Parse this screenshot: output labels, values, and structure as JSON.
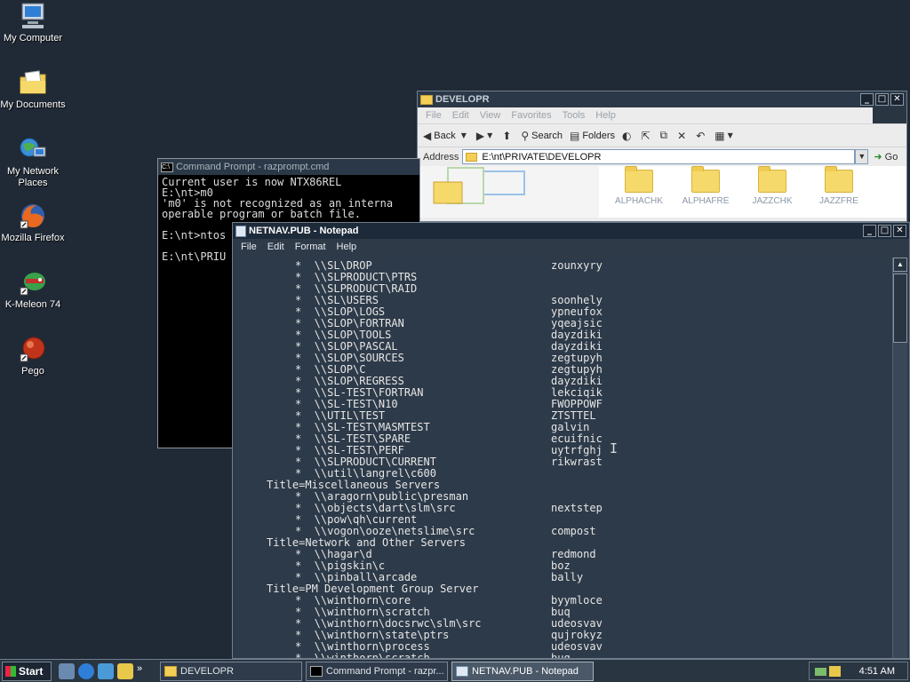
{
  "desktop": {
    "icons": [
      {
        "label": "My Computer"
      },
      {
        "label": "My Documents"
      },
      {
        "label": "My Network Places"
      },
      {
        "label": "Mozilla Firefox"
      },
      {
        "label": "K-Meleon 74"
      },
      {
        "label": "Pego"
      }
    ]
  },
  "explorer": {
    "title": "DEVELOPR",
    "menu": [
      "File",
      "Edit",
      "View",
      "Favorites",
      "Tools",
      "Help"
    ],
    "toolbar": {
      "back": "Back",
      "search": "Search",
      "folders": "Folders"
    },
    "address_label": "Address",
    "address_value": "E:\\nt\\PRIVATE\\DEVELOPR",
    "go_label": "Go",
    "folders": [
      "ALPHACHK",
      "ALPHAFRE",
      "JAZZCHK",
      "JAZZFRE"
    ]
  },
  "cmd": {
    "title": "Command Prompt - razprompt.cmd",
    "lines": [
      "Current user is now NTX86REL",
      "E:\\nt>m0",
      "'m0' is not recognized as an interna",
      "operable program or batch file.",
      "",
      "E:\\nt>ntos",
      "",
      "E:\\nt\\PRIU"
    ]
  },
  "notepad": {
    "title": "NETNAV.PUB - Notepad",
    "menu": [
      "File",
      "Edit",
      "Format",
      "Help"
    ],
    "rows": [
      {
        "a": "*  \\\\SL\\DROP",
        "b": "zounxyry"
      },
      {
        "a": "*  \\\\SLPRODUCT\\PTRS",
        "b": ""
      },
      {
        "a": "*  \\\\SLPRODUCT\\RAID",
        "b": ""
      },
      {
        "a": "*  \\\\SL\\USERS",
        "b": "soonhely"
      },
      {
        "a": "*  \\\\SLOP\\LOGS",
        "b": "ypneufox"
      },
      {
        "a": "*  \\\\SLOP\\FORTRAN",
        "b": "yqeajsic"
      },
      {
        "a": "*  \\\\SLOP\\TOOLS",
        "b": "dayzdiki"
      },
      {
        "a": "*  \\\\SLOP\\PASCAL",
        "b": "dayzdiki"
      },
      {
        "a": "*  \\\\SLOP\\SOURCES",
        "b": "zegtupyh"
      },
      {
        "a": "*  \\\\SLOP\\C",
        "b": "zegtupyh"
      },
      {
        "a": "*  \\\\SLOP\\REGRESS",
        "b": "dayzdiki"
      },
      {
        "a": "*  \\\\SL-TEST\\FORTRAN",
        "b": "lekciqik"
      },
      {
        "a": "*  \\\\SL-TEST\\N10",
        "b": "FWOPPOWF"
      },
      {
        "a": "*  \\\\UTIL\\TEST",
        "b": "ZTSTTEL"
      },
      {
        "a": "*  \\\\SL-TEST\\MASMTEST",
        "b": "galvin"
      },
      {
        "a": "*  \\\\SL-TEST\\SPARE",
        "b": "ecuifnic"
      },
      {
        "a": "*  \\\\SL-TEST\\PERF",
        "b": "uytrfghj"
      },
      {
        "a": "*  \\\\SLPRODUCT\\CURRENT",
        "b": "rikwrast"
      },
      {
        "a": "*  \\\\util\\langrel\\c600",
        "b": ""
      },
      {
        "a": "Title=Miscellaneous Servers",
        "b": "",
        "title": true
      },
      {
        "a": "*  \\\\aragorn\\public\\presman",
        "b": ""
      },
      {
        "a": "*  \\\\objects\\dart\\slm\\src",
        "b": "nextstep"
      },
      {
        "a": "*  \\\\pow\\qh\\current",
        "b": ""
      },
      {
        "a": "*  \\\\vogon\\ooze\\netslime\\src",
        "b": "compost"
      },
      {
        "a": "Title=Network and Other Servers",
        "b": "",
        "title": true
      },
      {
        "a": "*  \\\\hagar\\d",
        "b": "redmond"
      },
      {
        "a": "*  \\\\pigskin\\c",
        "b": "boz"
      },
      {
        "a": "*  \\\\pinball\\arcade",
        "b": "bally"
      },
      {
        "a": "Title=PM Development Group Server",
        "b": "",
        "title": true
      },
      {
        "a": "*  \\\\winthorn\\core",
        "b": "byymloce"
      },
      {
        "a": "*  \\\\winthorn\\scratch",
        "b": "buq"
      },
      {
        "a": "*  \\\\winthorn\\docsrwc\\slm\\src",
        "b": "udeosvav"
      },
      {
        "a": "*  \\\\winthorn\\state\\ptrs",
        "b": "qujrokyz"
      },
      {
        "a": "*  \\\\winthorn\\process",
        "b": "udeosvav"
      },
      {
        "a": "*  \\\\winthorn\\scratch",
        "b": "bug"
      }
    ]
  },
  "taskbar": {
    "start_label": "Start",
    "tasks": [
      "DEVELOPR",
      "Command Prompt - razpr...",
      "NETNAV.PUB - Notepad"
    ],
    "clock": "4:51 AM"
  },
  "colors": {
    "desktop": "#202a36",
    "window_frame": "#2e3a48",
    "notepad_bg": "#2d3a49"
  }
}
